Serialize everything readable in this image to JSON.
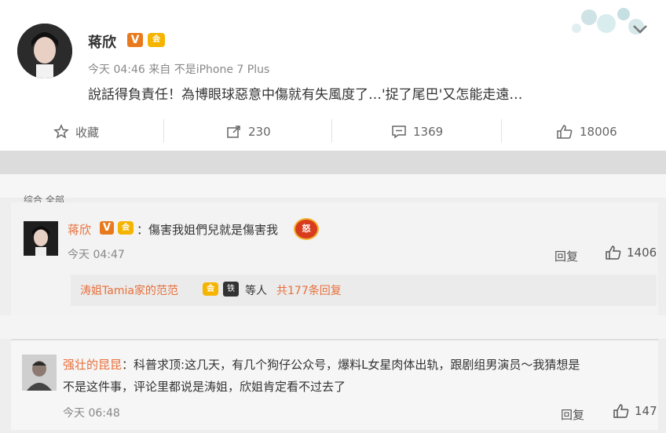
{
  "post": {
    "username": "蒋欣",
    "v_badge": "V",
    "vip_badge": "会",
    "time": "今天 04:46",
    "source_prefix": "来自",
    "source_device": "不是iPhone 7 Plus",
    "content": "說話得負責任！為博眼球惡意中傷就有失風度了…'捉了尾巴'又怎能走遠…",
    "actions": {
      "favorite_label": "收藏",
      "repost_count": "230",
      "comment_count": "1369",
      "like_count": "18006"
    }
  },
  "cutoff_text": "综合 全部",
  "comments": [
    {
      "username": "蒋欣",
      "v_badge": "V",
      "vip_badge": "会",
      "text": "：傷害我姐們兒就是傷害我",
      "emoji": "怒",
      "time": "今天 04:47",
      "reply_label": "回复",
      "like_count": "1406",
      "sub_replies": {
        "name": "涛姐Tamia家的范范",
        "badge": "铁",
        "etc": "等人",
        "count_text": "共177条回复"
      }
    },
    {
      "username": "强壮的昆昆",
      "text_line1": "：科普求顶:这几天，有几个狗仔公众号，爆料L女星肉体出轨，跟剧组男演员～我猜想是",
      "text_line2": "不是这件事，评论里都说是涛姐，欣姐肯定看不过去了",
      "time": "今天 06:48",
      "reply_label": "回复",
      "like_count": "147"
    }
  ],
  "colors": {
    "accent_orange": "#e86f3a",
    "v_badge": "#e8791c",
    "vip_gold": "#f5b400"
  }
}
